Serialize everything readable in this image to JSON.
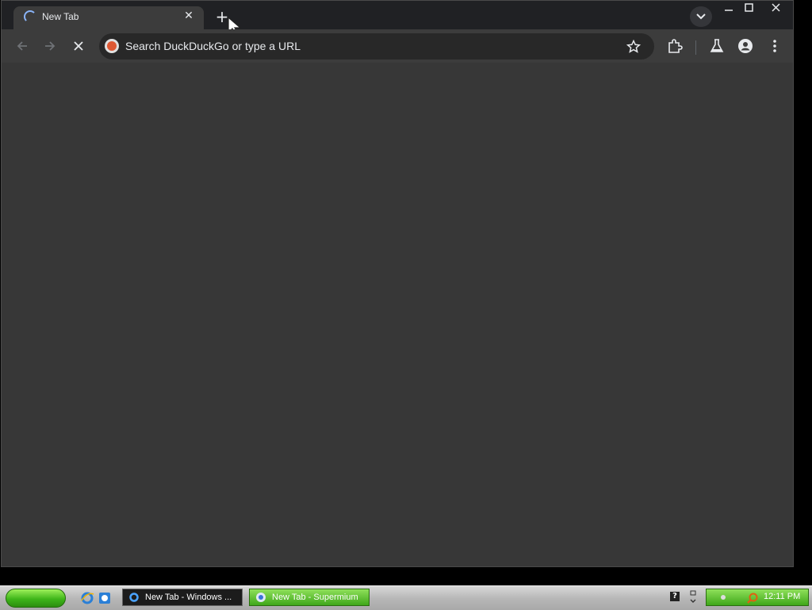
{
  "browser": {
    "tab": {
      "title": "New Tab",
      "close_icon": "close-icon",
      "loading_icon": "spinner-icon"
    },
    "new_tab_icon": "plus-icon",
    "tab_search_icon": "chevron-down-icon",
    "window_controls": [
      "minimize-icon",
      "maximize-icon",
      "close-icon"
    ],
    "toolbar": {
      "back_icon": "arrow-left-icon",
      "forward_icon": "arrow-right-icon",
      "stop_icon": "close-icon",
      "omnibox_placeholder": "Search DuckDuckGo or type a URL",
      "search_engine_icon": "duckduckgo-icon",
      "bookmark_icon": "star-icon",
      "extensions_icon": "puzzle-icon",
      "labs_icon": "flask-icon",
      "profile_icon": "person-icon",
      "menu_icon": "kebab-menu-icon"
    },
    "colors": {
      "titlebar": "#202124",
      "toolbar": "#3c3c3c",
      "content": "#373737",
      "omnibox": "#282828"
    }
  },
  "taskbar": {
    "tasks": [
      {
        "label": "New Tab - Windows ...",
        "icon": "internet-explorer-icon"
      },
      {
        "label": "New Tab - Supermium",
        "icon": "supermium-icon"
      }
    ],
    "quick_launch": [
      "internet-explorer-icon",
      "outlook-express-icon"
    ],
    "clock": "12:11 PM",
    "colors": {
      "start": "#3fb61a",
      "tray": "#3fa71a"
    }
  }
}
